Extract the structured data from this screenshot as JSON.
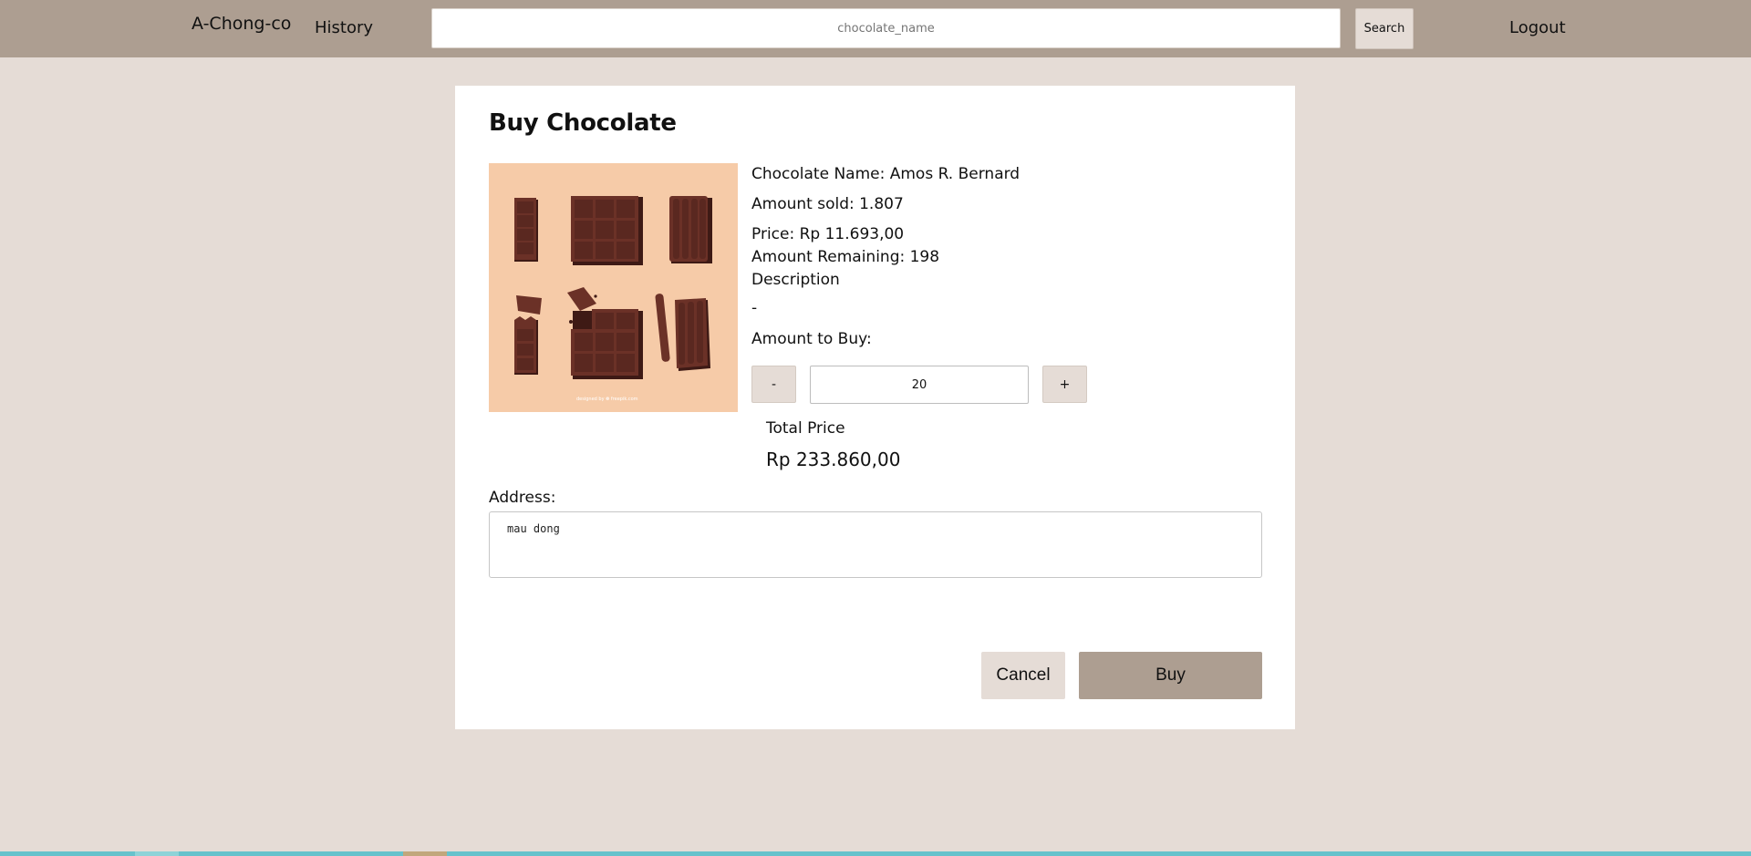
{
  "navbar": {
    "brand": "A-Chong-co",
    "history_label": "History",
    "search": {
      "placeholder": "chocolate_name",
      "value": ""
    },
    "search_button": "Search",
    "logout_label": "Logout"
  },
  "product": {
    "title": "Buy Chocolate",
    "image_credit": "designed by ❁ freepik.com",
    "name_line": "Chocolate Name: Amos R. Bernard",
    "sold_line": "Amount sold: 1.807",
    "price_line": "Price: Rp 11.693,00",
    "remaining_line": "Amount Remaining: 198",
    "description_label": "Description",
    "description_value": "-",
    "amount_label": "Amount to Buy:",
    "decrement_label": "-",
    "quantity_value": "20",
    "increment_label": "+",
    "total_label": "Total Price",
    "total_value": "Rp 233.860,00",
    "address_label": "Address:",
    "address_value": "mau dong"
  },
  "actions": {
    "cancel_label": "Cancel",
    "buy_label": "Buy"
  },
  "colors": {
    "page_bg": "#e5dcd6",
    "navbar_bg": "#ad9e91",
    "card_bg": "#ffffff",
    "image_bg": "#f6cba8",
    "chocolate": "#5e2a22"
  },
  "icons": {
    "product_image": "chocolate-bars-illustration"
  }
}
